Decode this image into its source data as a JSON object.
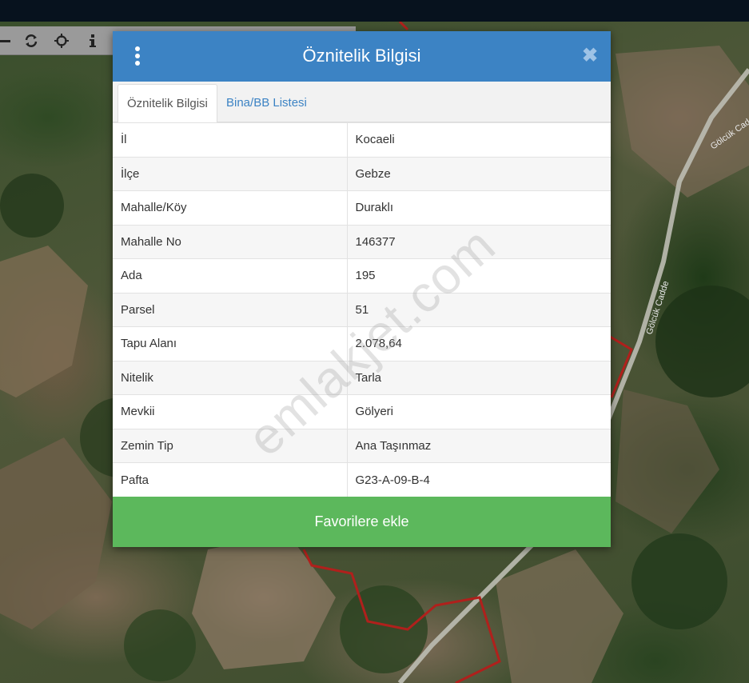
{
  "toolbar": {
    "tools": [
      {
        "name": "minus-icon"
      },
      {
        "name": "refresh-icon"
      },
      {
        "name": "crosshair-icon"
      },
      {
        "name": "info-icon"
      }
    ]
  },
  "map": {
    "road_label_1": "Gölcük Cad.",
    "road_label_2": "Gölcük Cadde"
  },
  "modal": {
    "title": "Öznitelik Bilgisi",
    "close_symbol": "✖",
    "tabs": [
      {
        "label": "Öznitelik Bilgisi",
        "active": true
      },
      {
        "label": "Bina/BB Listesi",
        "active": false
      }
    ],
    "rows": [
      {
        "key": "İl",
        "value": "Kocaeli"
      },
      {
        "key": "İlçe",
        "value": "Gebze"
      },
      {
        "key": "Mahalle/Köy",
        "value": "Duraklı"
      },
      {
        "key": "Mahalle No",
        "value": "146377"
      },
      {
        "key": "Ada",
        "value": "195"
      },
      {
        "key": "Parsel",
        "value": "51"
      },
      {
        "key": "Tapu Alanı",
        "value": "2.078,64"
      },
      {
        "key": "Nitelik",
        "value": "Tarla"
      },
      {
        "key": "Mevkii",
        "value": "Gölyeri"
      },
      {
        "key": "Zemin Tip",
        "value": "Ana Taşınmaz"
      },
      {
        "key": "Pafta",
        "value": "G23-A-09-B-4"
      }
    ],
    "favorite_button": "Favorilere ekle"
  },
  "watermark": "emlakjet.com",
  "colors": {
    "header": "#3c83c4",
    "favorite_button": "#5cb85c",
    "parcel_outline": "#b0201c"
  }
}
